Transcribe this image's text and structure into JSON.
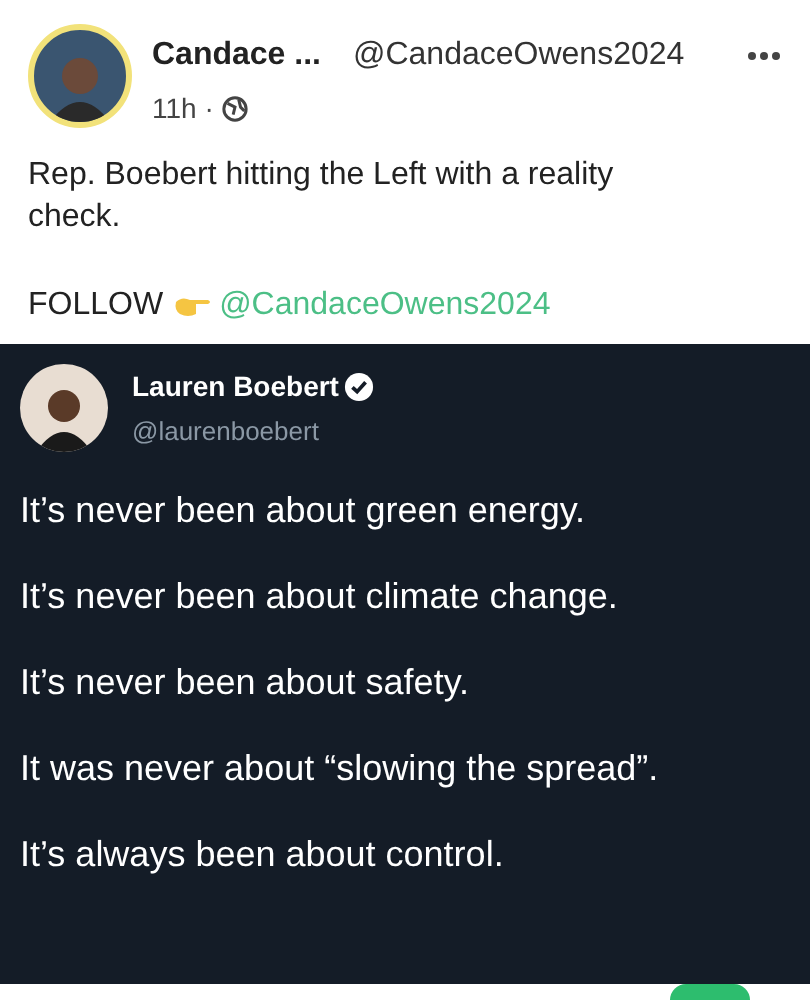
{
  "post": {
    "author_name": "Candace ...",
    "handle": "@CandaceOwens2024",
    "time": "11h ·",
    "text": "Rep. Boebert hitting the Left with a reality check.",
    "follow_label": "FOLLOW",
    "follow_handle": "@CandaceOwens2024"
  },
  "quoted_tweet": {
    "name": "Lauren Boebert",
    "verified": true,
    "handle": "@laurenboebert",
    "lines": [
      "It’s never been about green energy.",
      "It’s never been about climate change.",
      "It’s never been about safety.",
      "It was never about “slowing the spread”.",
      "It’s always been about control."
    ]
  }
}
